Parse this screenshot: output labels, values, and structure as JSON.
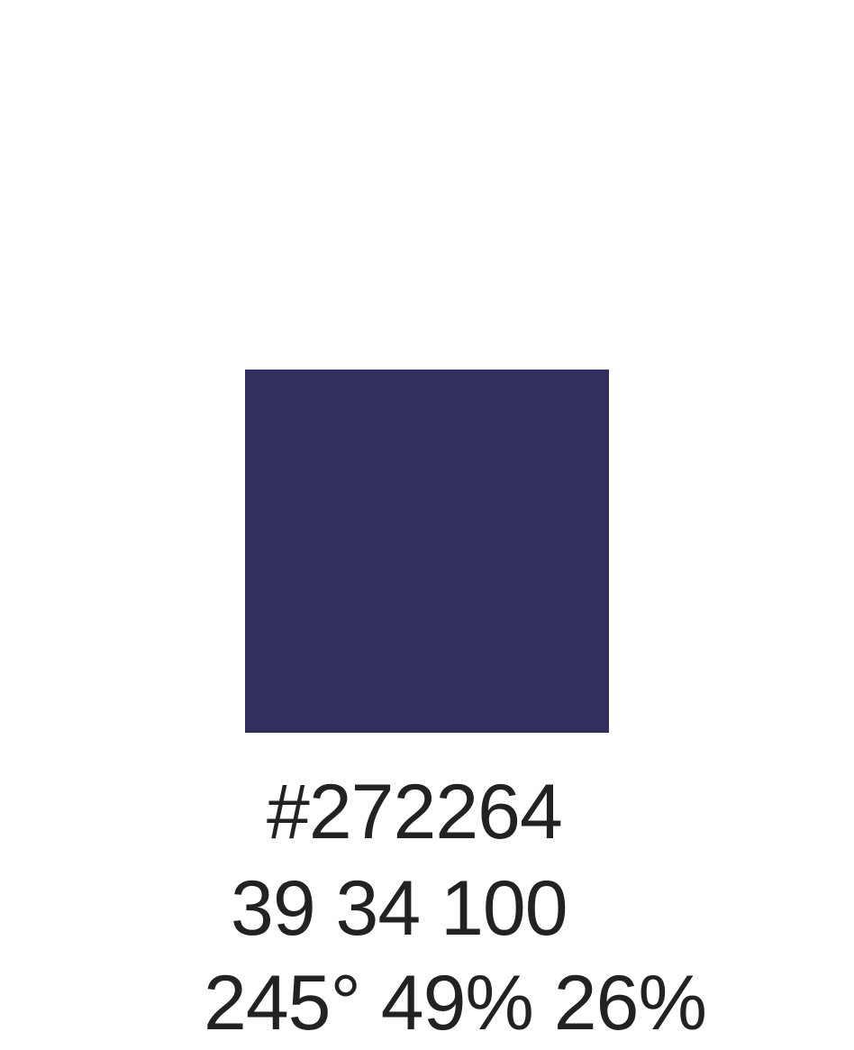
{
  "swatch": {
    "color": "#312f5e"
  },
  "labels": {
    "hex": "#272264",
    "rgb": "39 34 100",
    "hsl": "245° 49% 26%"
  },
  "text_color": "#222222"
}
